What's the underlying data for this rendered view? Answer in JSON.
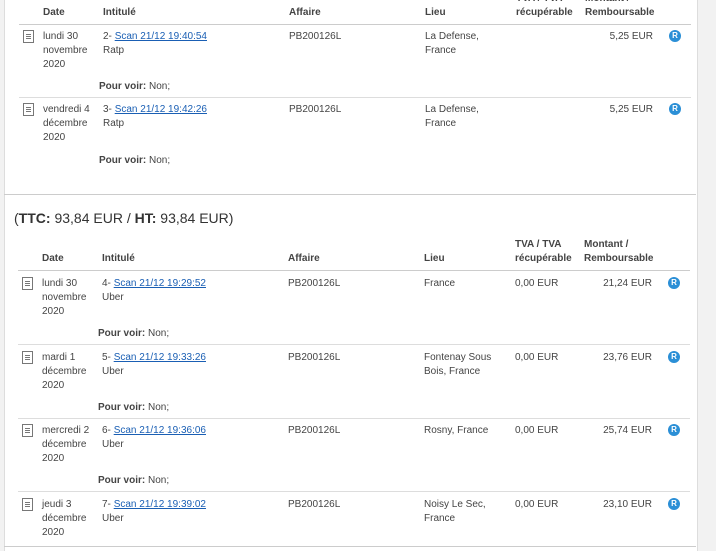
{
  "section1": {
    "headers": {
      "date": "Date",
      "intitule": "Intitulé",
      "affaire": "Affaire",
      "lieu": "Lieu",
      "tva": "TVA / TVA récupérable",
      "montant": "Montant / Remboursable"
    },
    "rows": [
      {
        "date": "lundi 30 novembre 2020",
        "num": "2-",
        "scan": "Scan 21/12 19:40:54",
        "vendor": "Ratp",
        "affaire": "PB200126L",
        "lieu": "La Defense, France",
        "tva": "",
        "montant": "5,25 EUR",
        "pour_label": "Pour voir:",
        "pour_value": "Non;",
        "badge": "R"
      },
      {
        "date": "vendredi 4 décembre 2020",
        "num": "3-",
        "scan": "Scan 21/12 19:42:26",
        "vendor": "Ratp",
        "affaire": "PB200126L",
        "lieu": "La Defense, France",
        "tva": "",
        "montant": "5,25 EUR",
        "pour_label": "Pour voir:",
        "pour_value": "Non;",
        "badge": "R"
      }
    ]
  },
  "total2": {
    "open": "(",
    "ttc_label": "TTC:",
    "ttc_value": "93,84 EUR",
    "slash": "/",
    "ht_label": "HT:",
    "ht_value": "93,84 EUR",
    "close": ")"
  },
  "section2": {
    "headers": {
      "date": "Date",
      "intitule": "Intitulé",
      "affaire": "Affaire",
      "lieu": "Lieu",
      "tva_1": "TVA / TVA",
      "tva_2": "récupérable",
      "montant_1": "Montant /",
      "montant_2": "Remboursable"
    },
    "rows": [
      {
        "date": "lundi 30 novembre 2020",
        "num": "4-",
        "scan": "Scan 21/12 19:29:52",
        "vendor": "Uber",
        "affaire": "PB200126L",
        "lieu": "France",
        "tva": "0,00 EUR",
        "montant": "21,24 EUR",
        "pour_label": "Pour voir:",
        "pour_value": "Non;",
        "badge": "R"
      },
      {
        "date": "mardi 1 décembre 2020",
        "num": "5-",
        "scan": "Scan 21/12 19:33:26",
        "vendor": "Uber",
        "affaire": "PB200126L",
        "lieu": "Fontenay Sous Bois, France",
        "tva": "0,00 EUR",
        "montant": "23,76 EUR",
        "pour_label": "Pour voir:",
        "pour_value": "Non;",
        "badge": "R"
      },
      {
        "date": "mercredi 2 décembre 2020",
        "num": "6-",
        "scan": "Scan 21/12 19:36:06",
        "vendor": "Uber",
        "affaire": "PB200126L",
        "lieu": "Rosny, France",
        "tva": "0,00 EUR",
        "montant": "25,74 EUR",
        "pour_label": "Pour voir:",
        "pour_value": "Non;",
        "badge": "R"
      },
      {
        "date": "jeudi 3 décembre 2020",
        "num": "7-",
        "scan": "Scan 21/12 19:39:02",
        "vendor": "Uber",
        "affaire": "PB200126L",
        "lieu": "Noisy Le Sec, France",
        "tva": "0,00 EUR",
        "montant": "23,10 EUR",
        "pour_label": "",
        "pour_value": "",
        "badge": "R"
      }
    ]
  }
}
